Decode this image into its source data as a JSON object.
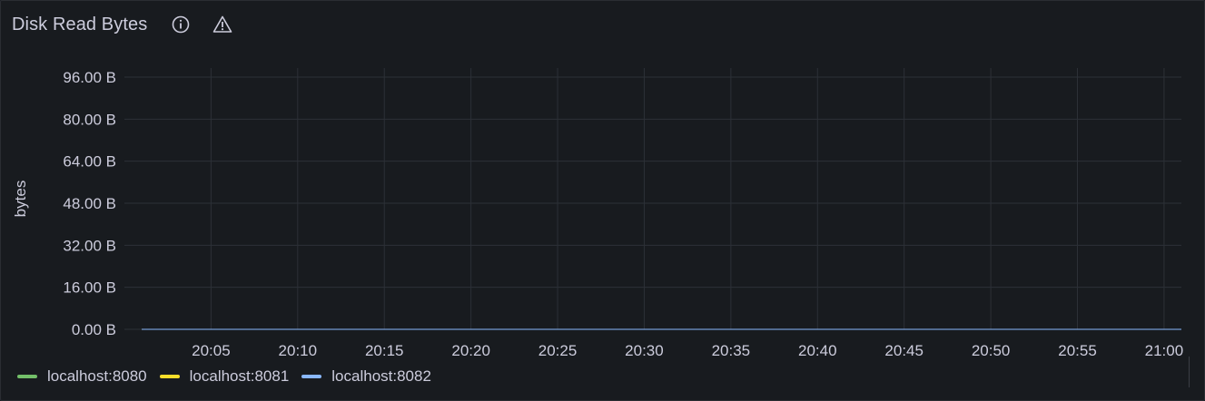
{
  "panel": {
    "title": "Disk Read Bytes",
    "icons": [
      "info-icon",
      "warning-icon"
    ]
  },
  "colors": {
    "background": "#181b1f",
    "grid": "#2c3037",
    "text": "#ccccdc"
  },
  "chart_data": {
    "type": "line",
    "ylabel": "bytes",
    "ylim": [
      0,
      96
    ],
    "yticks": [
      "0.00 B",
      "16.00 B",
      "32.00 B",
      "48.00 B",
      "64.00 B",
      "80.00 B",
      "96.00 B"
    ],
    "ytick_values": [
      0,
      16,
      32,
      48,
      64,
      80,
      96
    ],
    "xticks": [
      "20:05",
      "20:10",
      "20:15",
      "20:20",
      "20:25",
      "20:30",
      "20:35",
      "20:40",
      "20:45",
      "20:50",
      "20:55",
      "21:00"
    ],
    "xlim": [
      "20:00",
      "21:01"
    ],
    "grid": true,
    "legend_placement": "bottom-left",
    "series": [
      {
        "name": "localhost:8080",
        "color": "#73bf69",
        "x": [
          "20:01",
          "21:01"
        ],
        "values": [
          0,
          0
        ]
      },
      {
        "name": "localhost:8081",
        "color": "#fade2a",
        "x": [
          "20:01",
          "21:01"
        ],
        "values": [
          0,
          0
        ]
      },
      {
        "name": "localhost:8082",
        "color": "#8ab8ff",
        "x": [
          "20:01",
          "21:01"
        ],
        "values": [
          0,
          0
        ]
      }
    ]
  }
}
